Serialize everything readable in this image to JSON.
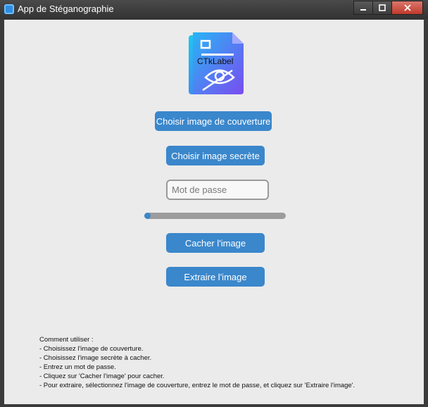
{
  "window": {
    "title": "App de Stéganographie"
  },
  "logo": {
    "icon": "document-eye-icon",
    "label": "CTkLabel"
  },
  "buttons": {
    "choose_cover": "Choisir image de couverture",
    "choose_secret": "Choisir image secrète",
    "hide": "Cacher l'image",
    "extract": "Extraire l'image"
  },
  "password": {
    "placeholder": "Mot de passe",
    "value": ""
  },
  "progress": {
    "value": 0.02
  },
  "instructions": {
    "lines": [
      "Comment utiliser :",
      "- Choisissez l'image de couverture.",
      "- Choisissez l'image secrète à cacher.",
      "- Entrez un mot de passe.",
      "- Cliquez sur 'Cacher l'image' pour cacher.",
      "- Pour extraire, sélectionnez l'image de couverture, entrez le mot de passe, et cliquez sur 'Extraire l'image'."
    ]
  },
  "colors": {
    "accent": "#3a87cc",
    "background": "#ebebeb",
    "progress_track": "#9c9c9c"
  }
}
